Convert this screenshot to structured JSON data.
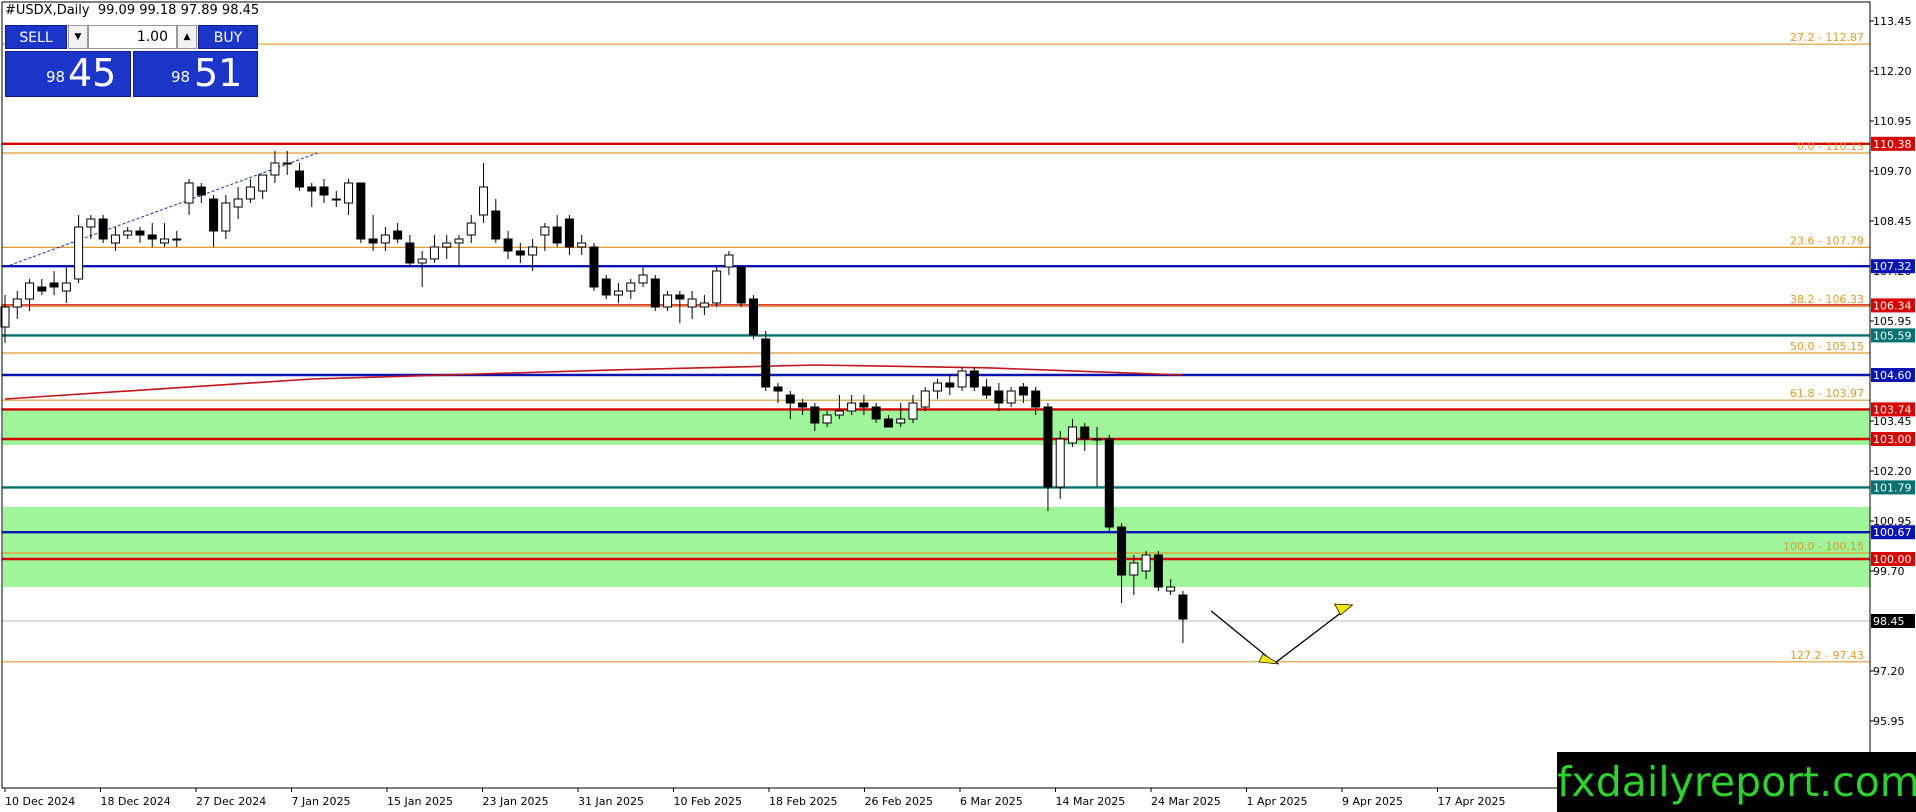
{
  "header": {
    "symbol_title": "#USDX,Daily",
    "ohlc": "99.09 99.18 97.89 98.45"
  },
  "trade_panel": {
    "sell_label": "SELL",
    "buy_label": "BUY",
    "lot_value": "1.00",
    "bid_small": "98",
    "bid_big": "45",
    "ask_small": "98",
    "ask_big": "51"
  },
  "brand": "fxdailyreport.com",
  "colors": {
    "fib": "#e09a2a",
    "red_level": "#d60000",
    "blue_level": "#0a14b4",
    "teal_level": "#007070",
    "zone": "#9ef59a",
    "ma": "#c0161c",
    "arrow": "#f5e60a"
  },
  "chart_data": {
    "type": "candlestick",
    "symbol": "#USDX",
    "timeframe": "Daily",
    "y_ticks": [
      113.45,
      112.2,
      110.95,
      109.7,
      108.45,
      107.2,
      105.95,
      103.45,
      102.2,
      100.95,
      99.7,
      97.2,
      95.95
    ],
    "ylim": [
      94.8,
      114.3
    ],
    "x_ticks": [
      "10 Dec 2024",
      "18 Dec 2024",
      "27 Dec 2024",
      "7 Jan 2025",
      "15 Jan 2025",
      "23 Jan 2025",
      "31 Jan 2025",
      "10 Feb 2025",
      "18 Feb 2025",
      "26 Feb 2025",
      "6 Mar 2025",
      "14 Mar 2025",
      "24 Mar 2025",
      "1 Apr 2025",
      "9 Apr 2025",
      "17 Apr 2025"
    ],
    "fib_levels": [
      {
        "label": "27.2 - 112.87",
        "value": 112.87
      },
      {
        "label": "0.0 - 110.15",
        "value": 110.15
      },
      {
        "label": "23.6 - 107.79",
        "value": 107.79
      },
      {
        "label": "38.2 - 106.33",
        "value": 106.33
      },
      {
        "label": "50.0 - 105.15",
        "value": 105.15
      },
      {
        "label": "61.8 - 103.97",
        "value": 103.97
      },
      {
        "label": "100.0 - 100.15",
        "value": 100.15
      },
      {
        "label": "127.2 - 97.43",
        "value": 97.43
      }
    ],
    "horizontal_levels": [
      {
        "value": 110.38,
        "label": "110.38",
        "kind": "red"
      },
      {
        "value": 107.32,
        "label": "107.32",
        "kind": "blue"
      },
      {
        "value": 106.34,
        "label": "106.34",
        "kind": "red"
      },
      {
        "value": 105.59,
        "label": "105.59",
        "kind": "teal"
      },
      {
        "value": 104.6,
        "label": "104.60",
        "kind": "blue"
      },
      {
        "value": 103.74,
        "label": "103.74",
        "kind": "red"
      },
      {
        "value": 103.0,
        "label": "103.00",
        "kind": "red"
      },
      {
        "value": 101.79,
        "label": "101.79",
        "kind": "teal"
      },
      {
        "value": 100.67,
        "label": "100.67",
        "kind": "blue"
      },
      {
        "value": 100.0,
        "label": "100.00",
        "kind": "red"
      }
    ],
    "current_price": {
      "value": 98.45,
      "label": "98.45"
    },
    "zones": [
      {
        "from": 102.85,
        "to": 103.75
      },
      {
        "from": 99.3,
        "to": 101.3
      }
    ],
    "candles": [
      {
        "o": 105.8,
        "h": 106.6,
        "l": 105.4,
        "c": 106.3
      },
      {
        "o": 106.3,
        "h": 106.7,
        "l": 106.0,
        "c": 106.5
      },
      {
        "o": 106.5,
        "h": 107.0,
        "l": 106.2,
        "c": 106.9
      },
      {
        "o": 106.8,
        "h": 107.0,
        "l": 106.6,
        "c": 106.7
      },
      {
        "o": 106.9,
        "h": 107.2,
        "l": 106.6,
        "c": 106.8
      },
      {
        "o": 106.7,
        "h": 107.3,
        "l": 106.4,
        "c": 106.9
      },
      {
        "o": 107.0,
        "h": 108.6,
        "l": 106.9,
        "c": 108.3
      },
      {
        "o": 108.3,
        "h": 108.6,
        "l": 108.0,
        "c": 108.5
      },
      {
        "o": 108.5,
        "h": 108.6,
        "l": 107.9,
        "c": 108.0
      },
      {
        "o": 107.9,
        "h": 108.3,
        "l": 107.7,
        "c": 108.1
      },
      {
        "o": 108.1,
        "h": 108.3,
        "l": 108.0,
        "c": 108.2
      },
      {
        "o": 108.2,
        "h": 108.3,
        "l": 107.9,
        "c": 108.1
      },
      {
        "o": 108.1,
        "h": 108.4,
        "l": 107.8,
        "c": 108.0
      },
      {
        "o": 107.9,
        "h": 108.4,
        "l": 107.8,
        "c": 108.0
      },
      {
        "o": 108.0,
        "h": 108.2,
        "l": 107.8,
        "c": 108.0
      },
      {
        "o": 108.9,
        "h": 109.5,
        "l": 108.6,
        "c": 109.4
      },
      {
        "o": 109.3,
        "h": 109.4,
        "l": 108.9,
        "c": 109.1
      },
      {
        "o": 109.0,
        "h": 109.1,
        "l": 107.8,
        "c": 108.2
      },
      {
        "o": 108.2,
        "h": 109.1,
        "l": 108.0,
        "c": 108.9
      },
      {
        "o": 108.8,
        "h": 109.3,
        "l": 108.5,
        "c": 109.0
      },
      {
        "o": 109.0,
        "h": 109.5,
        "l": 108.9,
        "c": 109.3
      },
      {
        "o": 109.2,
        "h": 109.6,
        "l": 109.0,
        "c": 109.6
      },
      {
        "o": 109.6,
        "h": 110.2,
        "l": 109.4,
        "c": 109.9
      },
      {
        "o": 109.9,
        "h": 110.2,
        "l": 109.6,
        "c": 109.9
      },
      {
        "o": 109.7,
        "h": 109.9,
        "l": 109.2,
        "c": 109.3
      },
      {
        "o": 109.3,
        "h": 109.4,
        "l": 108.8,
        "c": 109.2
      },
      {
        "o": 109.3,
        "h": 109.5,
        "l": 108.9,
        "c": 109.1
      },
      {
        "o": 109.0,
        "h": 109.2,
        "l": 108.8,
        "c": 109.0
      },
      {
        "o": 108.9,
        "h": 109.5,
        "l": 108.6,
        "c": 109.4
      },
      {
        "o": 109.4,
        "h": 109.4,
        "l": 107.9,
        "c": 108.0
      },
      {
        "o": 108.0,
        "h": 108.6,
        "l": 107.7,
        "c": 107.9
      },
      {
        "o": 107.9,
        "h": 108.3,
        "l": 107.7,
        "c": 108.1
      },
      {
        "o": 108.2,
        "h": 108.4,
        "l": 107.9,
        "c": 108.0
      },
      {
        "o": 107.9,
        "h": 108.1,
        "l": 107.3,
        "c": 107.4
      },
      {
        "o": 107.4,
        "h": 107.7,
        "l": 106.8,
        "c": 107.5
      },
      {
        "o": 107.5,
        "h": 108.1,
        "l": 107.4,
        "c": 107.8
      },
      {
        "o": 107.8,
        "h": 108.1,
        "l": 107.5,
        "c": 107.9
      },
      {
        "o": 107.9,
        "h": 108.1,
        "l": 107.3,
        "c": 108.0
      },
      {
        "o": 108.1,
        "h": 108.6,
        "l": 107.9,
        "c": 108.4
      },
      {
        "o": 108.6,
        "h": 109.9,
        "l": 108.4,
        "c": 109.3
      },
      {
        "o": 108.7,
        "h": 109.0,
        "l": 107.9,
        "c": 108.0
      },
      {
        "o": 108.0,
        "h": 108.2,
        "l": 107.5,
        "c": 107.7
      },
      {
        "o": 107.7,
        "h": 107.9,
        "l": 107.4,
        "c": 107.6
      },
      {
        "o": 107.6,
        "h": 108.0,
        "l": 107.2,
        "c": 107.8
      },
      {
        "o": 108.1,
        "h": 108.4,
        "l": 107.7,
        "c": 108.3
      },
      {
        "o": 108.3,
        "h": 108.6,
        "l": 107.8,
        "c": 107.9
      },
      {
        "o": 108.5,
        "h": 108.6,
        "l": 107.6,
        "c": 107.8
      },
      {
        "o": 107.8,
        "h": 108.1,
        "l": 107.6,
        "c": 107.9
      },
      {
        "o": 107.8,
        "h": 107.9,
        "l": 106.7,
        "c": 106.8
      },
      {
        "o": 107.0,
        "h": 107.1,
        "l": 106.5,
        "c": 106.6
      },
      {
        "o": 106.6,
        "h": 106.9,
        "l": 106.4,
        "c": 106.7
      },
      {
        "o": 106.7,
        "h": 107.0,
        "l": 106.5,
        "c": 106.9
      },
      {
        "o": 106.9,
        "h": 107.3,
        "l": 106.8,
        "c": 107.1
      },
      {
        "o": 107.0,
        "h": 107.1,
        "l": 106.2,
        "c": 106.3
      },
      {
        "o": 106.3,
        "h": 106.7,
        "l": 106.2,
        "c": 106.6
      },
      {
        "o": 106.6,
        "h": 106.7,
        "l": 105.9,
        "c": 106.5
      },
      {
        "o": 106.3,
        "h": 106.7,
        "l": 106.0,
        "c": 106.5
      },
      {
        "o": 106.3,
        "h": 106.6,
        "l": 106.1,
        "c": 106.4
      },
      {
        "o": 106.4,
        "h": 107.3,
        "l": 106.3,
        "c": 107.2
      },
      {
        "o": 107.3,
        "h": 107.7,
        "l": 107.1,
        "c": 107.6
      },
      {
        "o": 107.3,
        "h": 107.3,
        "l": 106.3,
        "c": 106.4
      },
      {
        "o": 106.5,
        "h": 106.6,
        "l": 105.5,
        "c": 105.6
      },
      {
        "o": 105.5,
        "h": 105.7,
        "l": 104.2,
        "c": 104.3
      },
      {
        "o": 104.3,
        "h": 104.4,
        "l": 103.9,
        "c": 104.2
      },
      {
        "o": 104.1,
        "h": 104.2,
        "l": 103.5,
        "c": 103.9
      },
      {
        "o": 103.9,
        "h": 104.0,
        "l": 103.6,
        "c": 103.8
      },
      {
        "o": 103.8,
        "h": 103.9,
        "l": 103.2,
        "c": 103.4
      },
      {
        "o": 103.4,
        "h": 103.7,
        "l": 103.3,
        "c": 103.6
      },
      {
        "o": 103.6,
        "h": 104.1,
        "l": 103.5,
        "c": 103.7
      },
      {
        "o": 103.7,
        "h": 104.1,
        "l": 103.6,
        "c": 103.9
      },
      {
        "o": 103.9,
        "h": 104.1,
        "l": 103.6,
        "c": 103.8
      },
      {
        "o": 103.8,
        "h": 103.9,
        "l": 103.4,
        "c": 103.5
      },
      {
        "o": 103.5,
        "h": 103.6,
        "l": 103.3,
        "c": 103.3
      },
      {
        "o": 103.4,
        "h": 103.9,
        "l": 103.3,
        "c": 103.5
      },
      {
        "o": 103.5,
        "h": 104.1,
        "l": 103.4,
        "c": 103.9
      },
      {
        "o": 103.8,
        "h": 104.3,
        "l": 103.7,
        "c": 104.2
      },
      {
        "o": 104.2,
        "h": 104.5,
        "l": 104.0,
        "c": 104.4
      },
      {
        "o": 104.4,
        "h": 104.6,
        "l": 104.1,
        "c": 104.3
      },
      {
        "o": 104.3,
        "h": 104.8,
        "l": 104.2,
        "c": 104.7
      },
      {
        "o": 104.7,
        "h": 104.8,
        "l": 104.2,
        "c": 104.3
      },
      {
        "o": 104.3,
        "h": 104.5,
        "l": 104.0,
        "c": 104.1
      },
      {
        "o": 104.2,
        "h": 104.4,
        "l": 103.7,
        "c": 103.9
      },
      {
        "o": 103.9,
        "h": 104.3,
        "l": 103.8,
        "c": 104.2
      },
      {
        "o": 104.3,
        "h": 104.4,
        "l": 103.9,
        "c": 104.1
      },
      {
        "o": 104.2,
        "h": 104.3,
        "l": 103.6,
        "c": 103.8
      },
      {
        "o": 103.8,
        "h": 103.9,
        "l": 101.2,
        "c": 101.8
      },
      {
        "o": 101.8,
        "h": 103.2,
        "l": 101.5,
        "c": 103.0
      },
      {
        "o": 102.9,
        "h": 103.5,
        "l": 102.8,
        "c": 103.3
      },
      {
        "o": 103.3,
        "h": 103.4,
        "l": 102.7,
        "c": 103.0
      },
      {
        "o": 103.0,
        "h": 103.3,
        "l": 101.8,
        "c": 103.0
      },
      {
        "o": 103.0,
        "h": 103.1,
        "l": 100.7,
        "c": 100.8
      },
      {
        "o": 100.8,
        "h": 100.9,
        "l": 98.9,
        "c": 99.6
      },
      {
        "o": 99.6,
        "h": 100.1,
        "l": 99.1,
        "c": 99.9
      },
      {
        "o": 99.7,
        "h": 100.2,
        "l": 99.5,
        "c": 100.1
      },
      {
        "o": 100.1,
        "h": 100.2,
        "l": 99.2,
        "c": 99.3
      },
      {
        "o": 99.2,
        "h": 99.5,
        "l": 99.1,
        "c": 99.3
      },
      {
        "o": 99.1,
        "h": 99.2,
        "l": 97.9,
        "c": 98.5
      }
    ],
    "moving_average": [
      {
        "i": 0,
        "v": 104.0
      },
      {
        "i": 25,
        "v": 104.5
      },
      {
        "i": 50,
        "v": 104.73
      },
      {
        "i": 66,
        "v": 104.85
      },
      {
        "i": 80,
        "v": 104.78
      },
      {
        "i": 96,
        "v": 104.6
      }
    ],
    "trendline": [
      {
        "i": 0,
        "v": 107.3
      },
      {
        "i": 24,
        "v": 110.15
      }
    ],
    "projection_arrow": [
      {
        "i": 98.3,
        "v": 98.7
      },
      {
        "i": 103.5,
        "v": 97.4
      },
      {
        "i": 109.5,
        "v": 98.8
      }
    ]
  }
}
